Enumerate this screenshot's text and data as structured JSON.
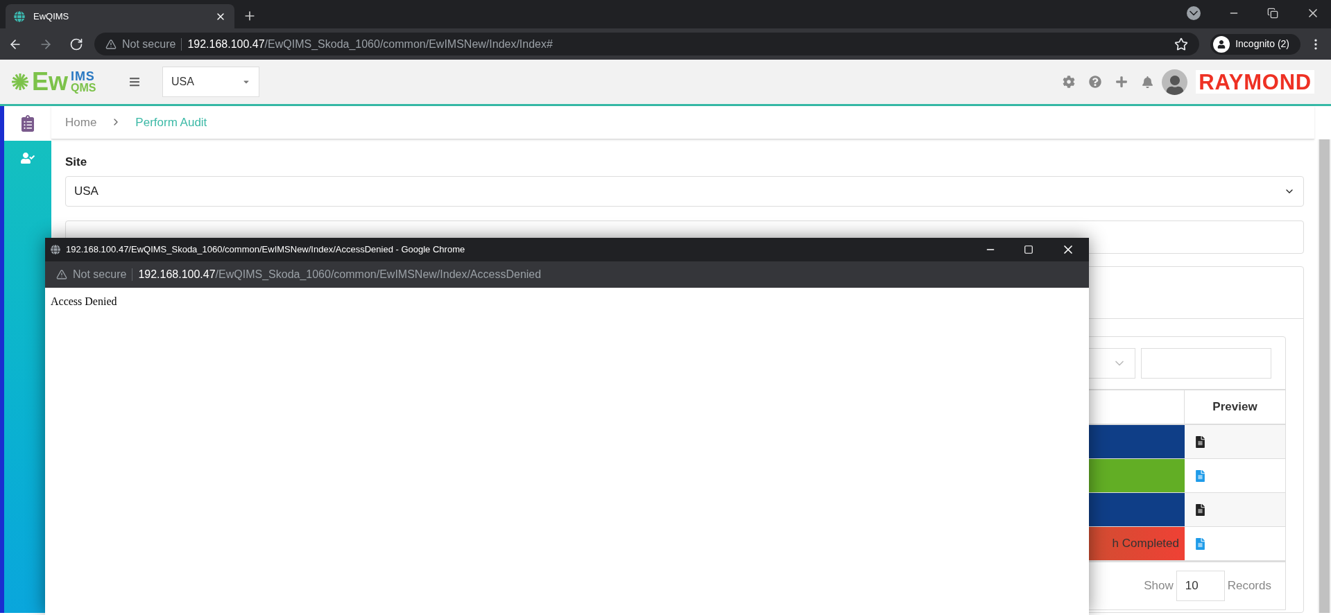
{
  "browser": {
    "tab_title": "EwQIMS",
    "url_insecure": "Not secure",
    "url_host": "192.168.100.47",
    "url_path": "/EwQIMS_Skoda_1060/common/EwIMSNew/Index/Index#",
    "profile": "Incognito (2)"
  },
  "app_header": {
    "logo_main": "Ew",
    "logo_top": "IMS",
    "logo_bottom": "QMS",
    "site_select": "USA",
    "brand": "RAYMOND"
  },
  "sidebar": {
    "items": [
      {
        "kind": "clipboard",
        "selected": true
      },
      {
        "kind": "user-check",
        "selected": false
      }
    ]
  },
  "breadcrumb": [
    "Home",
    "Perform Audit"
  ],
  "form": {
    "site_label": "Site",
    "site_value": "USA"
  },
  "table": {
    "columns": [
      "Preview"
    ],
    "rows": [
      {
        "color": "#0f3e87",
        "preview": {
          "color": "#222222"
        }
      },
      {
        "color": "#62ae25",
        "preview": {
          "color": "#1e9be9"
        }
      },
      {
        "color": "#0f3e87",
        "preview": {
          "color": "#222222"
        }
      },
      {
        "color": "#ef4135",
        "status": "h Completed",
        "preview": {
          "color": "#1e9be9"
        }
      }
    ]
  },
  "pagination": {
    "show": "Show",
    "count": "10",
    "records": "Records"
  },
  "popup": {
    "title": "192.168.100.47/EwQIMS_Skoda_1060/common/EwIMSNew/Index/AccessDenied - Google Chrome",
    "insecure": "Not secure",
    "host": "192.168.100.47",
    "path": "/EwQIMS_Skoda_1060/common/EwIMSNew/Index/AccessDenied",
    "body": "Access Denied"
  }
}
